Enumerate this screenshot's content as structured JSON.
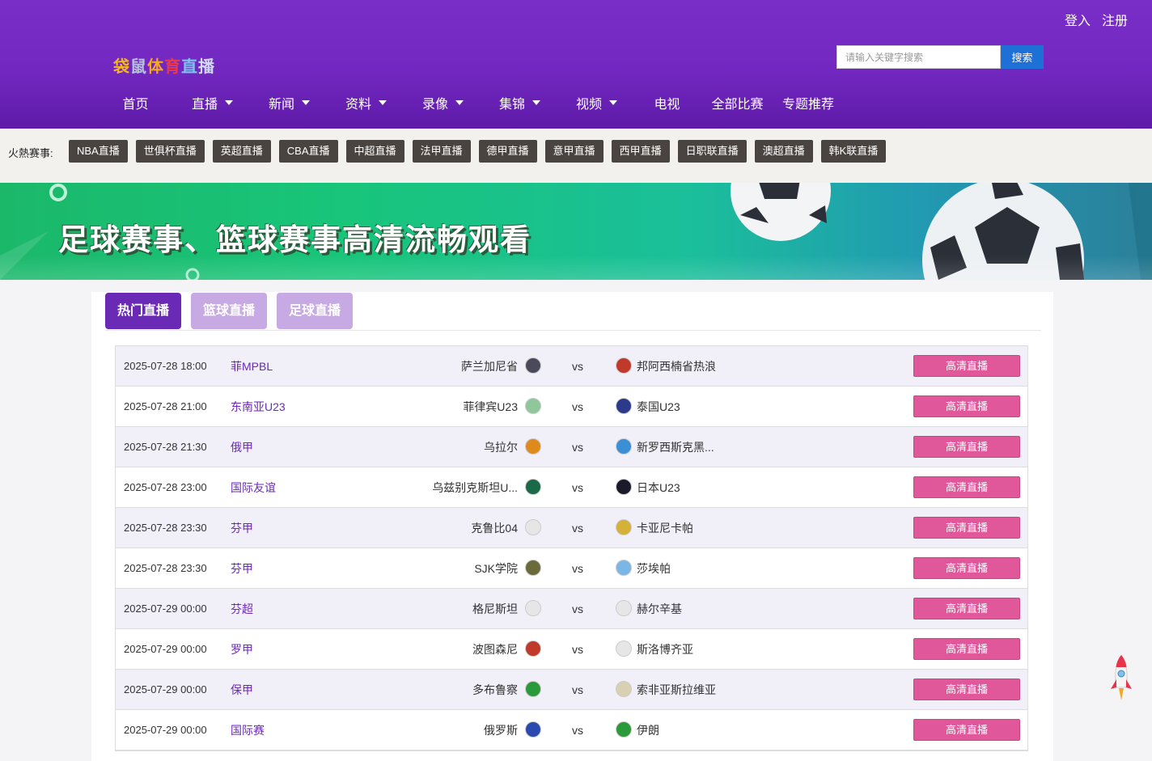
{
  "auth": {
    "login": "登入",
    "register": "注册"
  },
  "logo": {
    "chars": [
      {
        "text": "袋",
        "color": "#f4b71c"
      },
      {
        "text": "鼠",
        "color": "#b7c2e0"
      },
      {
        "text": "体",
        "color": "#f5a623"
      },
      {
        "text": "育",
        "color": "#e63a52"
      },
      {
        "text": "直",
        "color": "#7ec3f0"
      },
      {
        "text": "播",
        "color": "#cfd8f5"
      }
    ]
  },
  "search": {
    "placeholder": "请输入关键字搜索",
    "button": "搜索"
  },
  "nav": [
    {
      "label": "首页",
      "dropdown": false
    },
    {
      "label": "直播",
      "dropdown": true
    },
    {
      "label": "新闻",
      "dropdown": true
    },
    {
      "label": "资料",
      "dropdown": true
    },
    {
      "label": "录像",
      "dropdown": true
    },
    {
      "label": "集锦",
      "dropdown": true
    },
    {
      "label": "视频",
      "dropdown": true
    },
    {
      "label": "电视",
      "dropdown": false
    },
    {
      "label": "全部比赛",
      "dropdown": false
    },
    {
      "label": "专题推荐",
      "dropdown": false
    }
  ],
  "hot": {
    "label": "火熱赛事:",
    "tags": [
      "NBA直播",
      "世俱杯直播",
      "英超直播",
      "CBA直播",
      "中超直播",
      "法甲直播",
      "德甲直播",
      "意甲直播",
      "西甲直播",
      "日职联直播",
      "澳超直播",
      "韩K联直播"
    ]
  },
  "banner": {
    "title": "足球赛事、篮球赛事高清流畅观看"
  },
  "tabs": [
    {
      "label": "热门直播",
      "active": true
    },
    {
      "label": "篮球直播",
      "active": false
    },
    {
      "label": "足球直播",
      "active": false
    }
  ],
  "matches": [
    {
      "time": "2025-07-28 18:00",
      "league": "菲MPBL",
      "home": "萨兰加尼省",
      "away": "邦阿西楠省热浪",
      "home_logo": "#4a4a5a",
      "away_logo": "#c0392b",
      "button": "高清直播"
    },
    {
      "time": "2025-07-28 21:00",
      "league": "东南亚U23",
      "home": "菲律宾U23",
      "away": "泰国U23",
      "home_logo": "#8fc79a",
      "away_logo": "#2b3a8a",
      "button": "高清直播"
    },
    {
      "time": "2025-07-28 21:30",
      "league": "俄甲",
      "home": "乌拉尔",
      "away": "新罗西斯克黑...",
      "home_logo": "#e08a1e",
      "away_logo": "#3a8fd6",
      "button": "高清直播"
    },
    {
      "time": "2025-07-28 23:00",
      "league": "国际友谊",
      "home": "乌兹别克斯坦U...",
      "away": "日本U23",
      "home_logo": "#1a6a4a",
      "away_logo": "#1a1a2a",
      "button": "高清直播"
    },
    {
      "time": "2025-07-28 23:30",
      "league": "芬甲",
      "home": "克鲁比04",
      "away": "卡亚尼卡帕",
      "home_logo": "#e6e6e6",
      "away_logo": "#d4b23a",
      "button": "高清直播"
    },
    {
      "time": "2025-07-28 23:30",
      "league": "芬甲",
      "home": "SJK学院",
      "away": "莎埃帕",
      "home_logo": "#6a6a3a",
      "away_logo": "#7ab6e6",
      "button": "高清直播"
    },
    {
      "time": "2025-07-29 00:00",
      "league": "芬超",
      "home": "格尼斯坦",
      "away": "赫尔辛基",
      "home_logo": "#e6e6e6",
      "away_logo": "#e6e6e6",
      "button": "高清直播"
    },
    {
      "time": "2025-07-29 00:00",
      "league": "罗甲",
      "home": "波图森尼",
      "away": "斯洛博齐亚",
      "home_logo": "#c0392b",
      "away_logo": "#e6e6e6",
      "button": "高清直播"
    },
    {
      "time": "2025-07-29 00:00",
      "league": "保甲",
      "home": "多布鲁察",
      "away": "索非亚斯拉维亚",
      "home_logo": "#2a9a3a",
      "away_logo": "#d8d0b0",
      "button": "高清直播"
    },
    {
      "time": "2025-07-29 00:00",
      "league": "国际赛",
      "home": "俄罗斯",
      "away": "伊朗",
      "home_logo": "#2a4ab0",
      "away_logo": "#2a9a3a",
      "button": "高清直播"
    }
  ]
}
